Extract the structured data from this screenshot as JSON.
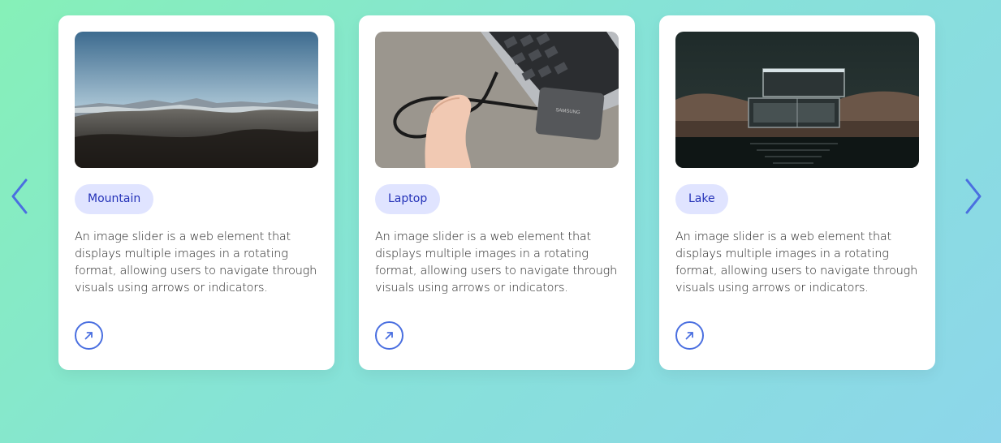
{
  "slider": {
    "prev_icon": "chevron-left-icon",
    "next_icon": "chevron-right-icon",
    "arrow_color": "#4a6fe0",
    "cards": [
      {
        "image": "mountain-landscape",
        "tag": "Mountain",
        "description": "An image slider is a web element that displays multiple images in a rotating format, allowing users to navigate through visuals using arrows or indicators.",
        "link_icon": "arrow-up-right-icon"
      },
      {
        "image": "laptop-with-ssd",
        "tag": "Laptop",
        "description": "An image slider is a web element that displays multiple images in a rotating format, allowing users to navigate through visuals using arrows or indicators.",
        "link_icon": "arrow-up-right-icon"
      },
      {
        "image": "lake-glass-house",
        "tag": "Lake",
        "description": "An image slider is a web element that displays multiple images in a rotating format, allowing users to navigate through visuals using arrows or indicators.",
        "link_icon": "arrow-up-right-icon"
      }
    ]
  },
  "colors": {
    "tag_bg": "#e0e4ff",
    "tag_text": "#2432b8",
    "accent": "#4a6fe0",
    "card_bg": "#ffffff"
  }
}
